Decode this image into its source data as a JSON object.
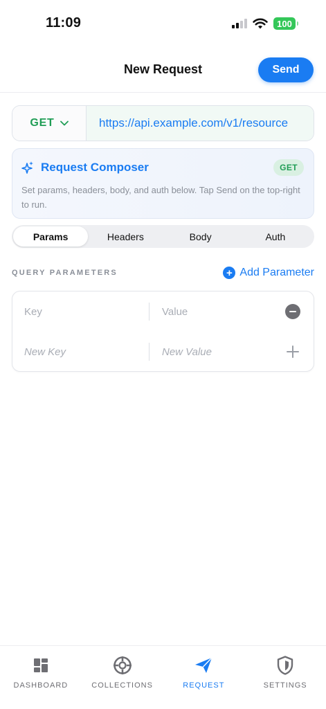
{
  "status_bar": {
    "time": "11:09",
    "battery": "100"
  },
  "nav": {
    "title": "New Request",
    "send_label": "Send"
  },
  "request": {
    "method": "GET",
    "url": "https://api.example.com/v1/resource"
  },
  "composer": {
    "title": "Request Composer",
    "badge": "GET",
    "description": "Set params, headers, body, and auth below. Tap Send on the top-right to run."
  },
  "tabs": [
    {
      "label": "Params",
      "active": true
    },
    {
      "label": "Headers",
      "active": false
    },
    {
      "label": "Body",
      "active": false
    },
    {
      "label": "Auth",
      "active": false
    }
  ],
  "query_params": {
    "section_title": "QUERY PARAMETERS",
    "add_label": "Add Parameter",
    "rows": [
      {
        "key_placeholder": "Key",
        "value_placeholder": "Value"
      },
      {
        "key_placeholder": "New Key",
        "value_placeholder": "New Value"
      }
    ]
  },
  "tab_bar": {
    "items": [
      {
        "label": "DASHBOARD",
        "icon": "dashboard-icon",
        "active": false
      },
      {
        "label": "COLLECTIONS",
        "icon": "collections-icon",
        "active": false
      },
      {
        "label": "REQUEST",
        "icon": "paper-plane-icon",
        "active": true
      },
      {
        "label": "SETTINGS",
        "icon": "shield-icon",
        "active": false
      }
    ]
  },
  "colors": {
    "accent": "#1a7cf2",
    "method_green": "#1f9d55",
    "battery_green": "#34c759"
  }
}
